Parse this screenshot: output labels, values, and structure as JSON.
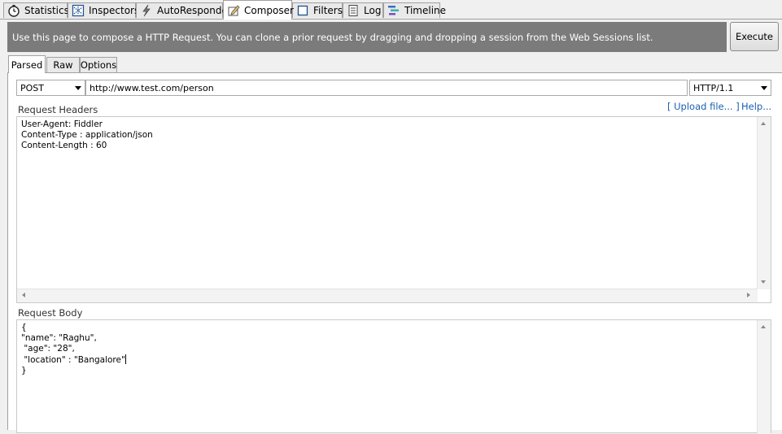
{
  "top_tabs": [
    {
      "label": "Statistics",
      "icon": "stopwatch-icon"
    },
    {
      "label": "Inspectors",
      "icon": "inspector-icon"
    },
    {
      "label": "AutoResponder",
      "icon": "lightning-icon"
    },
    {
      "label": "Composer",
      "icon": "composer-icon",
      "active": true
    },
    {
      "label": "Filters",
      "icon": "checkbox-icon"
    },
    {
      "label": "Log",
      "icon": "document-icon"
    },
    {
      "label": "Timeline",
      "icon": "timeline-icon"
    }
  ],
  "banner": {
    "text": "Use this page to compose a HTTP Request. You can clone a prior request by dragging and dropping a session from the Web Sessions list.",
    "execute_label": "Execute"
  },
  "inner_tabs": [
    {
      "label": "Parsed",
      "active": true
    },
    {
      "label": "Raw"
    },
    {
      "label": "Options"
    }
  ],
  "request": {
    "method": "POST",
    "url": "http://www.test.com/person",
    "version": "HTTP/1.1"
  },
  "headers": {
    "label": "Request Headers",
    "upload_link": "[ Upload file... ]",
    "help_link": "Help...",
    "text": "User-Agent: Fiddler\nContent-Type : application/json\nContent-Length : 60"
  },
  "body": {
    "label": "Request Body",
    "text": "{\n\"name\": \"Raghu\",\n \"age\": \"28\",\n \"location\" : \"Bangalore\""
  },
  "body_close": "}",
  "colors": {
    "banner": "#7b7b7b",
    "link": "#1a5fb4"
  }
}
